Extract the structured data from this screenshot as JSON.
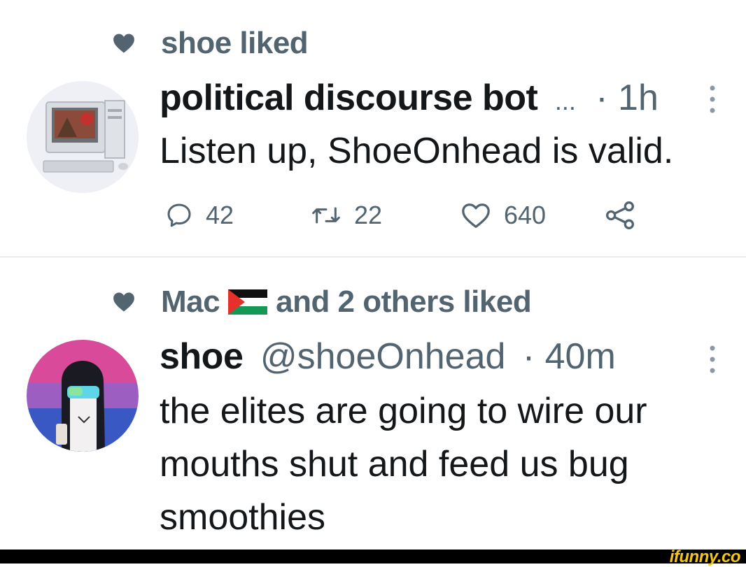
{
  "tweet1": {
    "liked_by": "shoe liked",
    "name": "political discourse bot",
    "ellipsis": "...",
    "time": "· 1h",
    "text": "Listen up, ShoeOnhead is valid.",
    "reply_count": "42",
    "retweet_count": "22",
    "like_count": "640"
  },
  "tweet2": {
    "liked_by_name": "Mac",
    "liked_by_rest": "and 2 others liked",
    "name": "shoe",
    "handle": "@shoeOnhead",
    "time": "· 40m",
    "text_lines": [
      "the elites are going to wire our",
      "mouths shut and feed us bug",
      "smoothies"
    ]
  },
  "footer": {
    "brand": "ifunny.co"
  },
  "colors": {
    "muted": "#536471",
    "text": "#14171a",
    "brand": "#f5c518"
  },
  "icons": [
    "heart-icon",
    "more-icon",
    "reply-icon",
    "retweet-icon",
    "like-icon",
    "share-icon",
    "palestine-flag-icon"
  ]
}
